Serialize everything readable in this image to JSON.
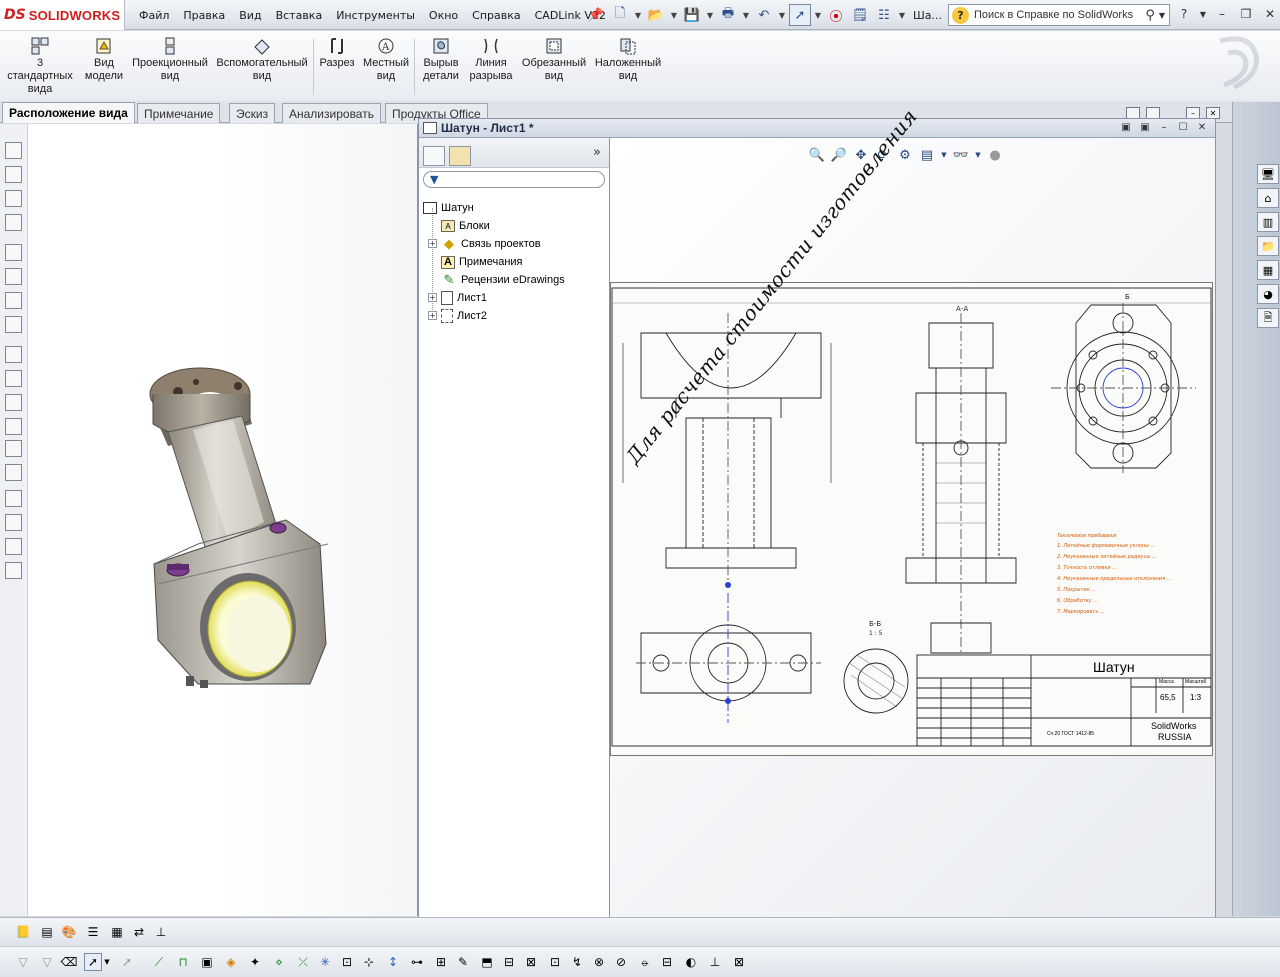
{
  "app": {
    "brand": "SOLIDWORKS",
    "logo_prefix": "DS"
  },
  "menu": [
    "Файл",
    "Правка",
    "Вид",
    "Вставка",
    "Инструменты",
    "Окно",
    "Справка",
    "CADLink V12"
  ],
  "quick_access": {
    "tail_text": "Ша..."
  },
  "help_search": {
    "placeholder": "Поиск в Справке по SolidWorks"
  },
  "command_manager": {
    "items": [
      {
        "label": "3\nстандартных\nвида"
      },
      {
        "label": "Вид\nмодели"
      },
      {
        "label": "Проекционный\nвид"
      },
      {
        "label": "Вспомогательный\nвид"
      },
      {
        "label": "Разрез"
      },
      {
        "label": "Местный\nвид"
      },
      {
        "label": "Вырыв\nдетали"
      },
      {
        "label": "Линия\nразрыва"
      },
      {
        "label": "Обрезанный\nвид"
      },
      {
        "label": "Наложенный\nвид"
      }
    ]
  },
  "tabs": [
    {
      "label": "Расположение вида",
      "active": true
    },
    {
      "label": "Примечание",
      "active": false
    },
    {
      "label": "Эскиз",
      "active": false
    },
    {
      "label": "Анализировать",
      "active": false
    },
    {
      "label": "Продукты Office",
      "active": false
    }
  ],
  "drawing_window": {
    "title": "Шатун - Лист1 *"
  },
  "feature_tree": {
    "root": "Шатун",
    "items": [
      {
        "label": "Блоки",
        "expandable": false,
        "icon": "blocks-icon"
      },
      {
        "label": "Связь проектов",
        "expandable": true,
        "icon": "design-binder-icon"
      },
      {
        "label": "Примечания",
        "expandable": false,
        "icon": "annotations-icon"
      },
      {
        "label": "Рецензии eDrawings",
        "expandable": false,
        "icon": "edrawings-icon"
      },
      {
        "label": "Лист1",
        "expandable": true,
        "icon": "sheet-icon"
      },
      {
        "label": "Лист2",
        "expandable": true,
        "icon": "sheet-icon"
      }
    ]
  },
  "drawing_sheet": {
    "watermark": "Для расчета стоимости изготовления",
    "title_block": {
      "part_name": "Шатун",
      "mass": "65,5",
      "scale": "1:3",
      "company_line1": "SolidWorks",
      "company_line2": "RUSSIA",
      "material": "Сч 20 ГОСТ 1412-85",
      "mass_header": "Масса",
      "scale_header": "Масштаб"
    },
    "section_labels": [
      "А-А",
      "Б",
      "Б-Б",
      "1 : 5"
    ],
    "notes_title": "Технические требования",
    "notes_lines": [
      "1. Литейные формовочные уклоны ...",
      "2. Неуказанные литейные радиусы ...",
      "3. Точность отливки ...",
      "4. Неуказанные предельные отклонения ...",
      "5. Покрытие ...",
      "6. Обработку ...",
      "7. Маркировать ..."
    ]
  },
  "colors": {
    "accent": "#d01d1d",
    "sheet_notes": "#d85a00",
    "selection_blue": "#2a3fd0",
    "model_purple": "#8a4a9a",
    "model_yellow": "#d9d400"
  }
}
